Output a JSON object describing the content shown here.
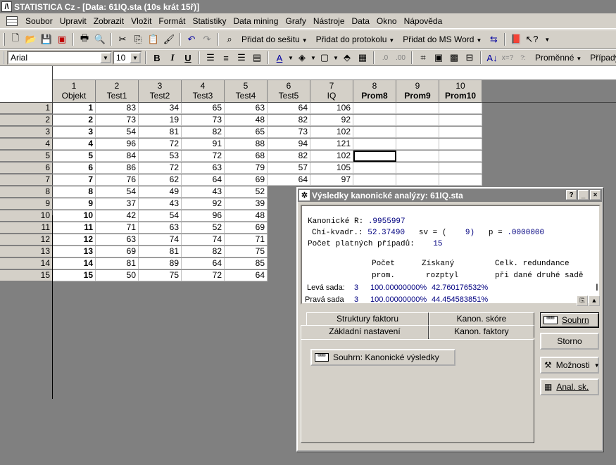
{
  "app": {
    "title": "STATISTICA Cz - [Data: 61IQ.sta (10s krát 15ř)]"
  },
  "menu": [
    "Soubor",
    "Upravit",
    "Zobrazit",
    "Vložit",
    "Formát",
    "Statistiky",
    "Data mining",
    "Grafy",
    "Nástroje",
    "Data",
    "Okno",
    "Nápověda"
  ],
  "toolbar1": {
    "add_workbook": "Přidat do sešitu",
    "add_report": "Přidat do protokolu",
    "add_word": "Přidat do MS Word"
  },
  "toolbar2": {
    "font": "Arial",
    "size": "10",
    "bold": "B",
    "italic": "I",
    "underline": "U",
    "variables": "Proměnné",
    "cases": "Případy"
  },
  "columns": [
    {
      "num": "1",
      "name": "Objekt"
    },
    {
      "num": "2",
      "name": "Test1"
    },
    {
      "num": "3",
      "name": "Test2"
    },
    {
      "num": "4",
      "name": "Test3"
    },
    {
      "num": "5",
      "name": "Test4"
    },
    {
      "num": "6",
      "name": "Test5"
    },
    {
      "num": "7",
      "name": "IQ"
    },
    {
      "num": "8",
      "name": "Prom8"
    },
    {
      "num": "9",
      "name": "Prom9"
    },
    {
      "num": "10",
      "name": "Prom10"
    }
  ],
  "rows": [
    [
      "1",
      "83",
      "34",
      "65",
      "63",
      "64",
      "106"
    ],
    [
      "2",
      "73",
      "19",
      "73",
      "48",
      "82",
      "92"
    ],
    [
      "3",
      "54",
      "81",
      "82",
      "65",
      "73",
      "102"
    ],
    [
      "4",
      "96",
      "72",
      "91",
      "88",
      "94",
      "121"
    ],
    [
      "5",
      "84",
      "53",
      "72",
      "68",
      "82",
      "102"
    ],
    [
      "6",
      "86",
      "72",
      "63",
      "79",
      "57",
      "105"
    ],
    [
      "7",
      "76",
      "62",
      "64",
      "69",
      "64",
      "97"
    ],
    [
      "8",
      "54",
      "49",
      "43",
      "52"
    ],
    [
      "9",
      "37",
      "43",
      "92",
      "39"
    ],
    [
      "10",
      "42",
      "54",
      "96",
      "48"
    ],
    [
      "11",
      "71",
      "63",
      "52",
      "69"
    ],
    [
      "12",
      "63",
      "74",
      "74",
      "71"
    ],
    [
      "13",
      "69",
      "81",
      "82",
      "75"
    ],
    [
      "14",
      "81",
      "89",
      "64",
      "85"
    ],
    [
      "15",
      "50",
      "75",
      "72",
      "64"
    ]
  ],
  "dialog": {
    "title": "Výsledky kanonické analýzy: 61IQ.sta",
    "win_help": "?",
    "win_min": "_",
    "win_close": "×",
    "r_label": "Kanonické R:",
    "r_value": ".9955997",
    "chi_label": "Chí-kvadr.:",
    "chi_value": "52.37490",
    "sv_label": "sv = (",
    "sv_value": "9)",
    "p_label": "p =",
    "p_value": ".0000000",
    "valid_label": "Počet platných případů:",
    "valid_value": "15",
    "hdr_count_1": "Počet",
    "hdr_count_2": "prom.",
    "hdr_var_1": "Získaný",
    "hdr_var_2": "rozptyl",
    "hdr_red_1": "Celk. redundance",
    "hdr_red_2": "při dané druhé sadě",
    "left_label": "Levá sada:",
    "left_count": "3",
    "left_var": "100.00000000%",
    "left_red": "42.760176532%",
    "right_label": "Pravá sada",
    "right_count": "3",
    "right_var": "100.00000000%",
    "right_red": "44.454583851%",
    "tabs": {
      "structure": "Struktury faktoru",
      "scores": "Kanon. skóre",
      "basic": "Základní nastavení",
      "factors": "Kanon. faktory"
    },
    "summary_results_btn": "Souhrn:  Kanonické výsledky",
    "summary_btn": "Souhrn",
    "cancel_btn": "Storno",
    "options_btn": "Možnosti",
    "anal_btn": "Anal. sk."
  }
}
